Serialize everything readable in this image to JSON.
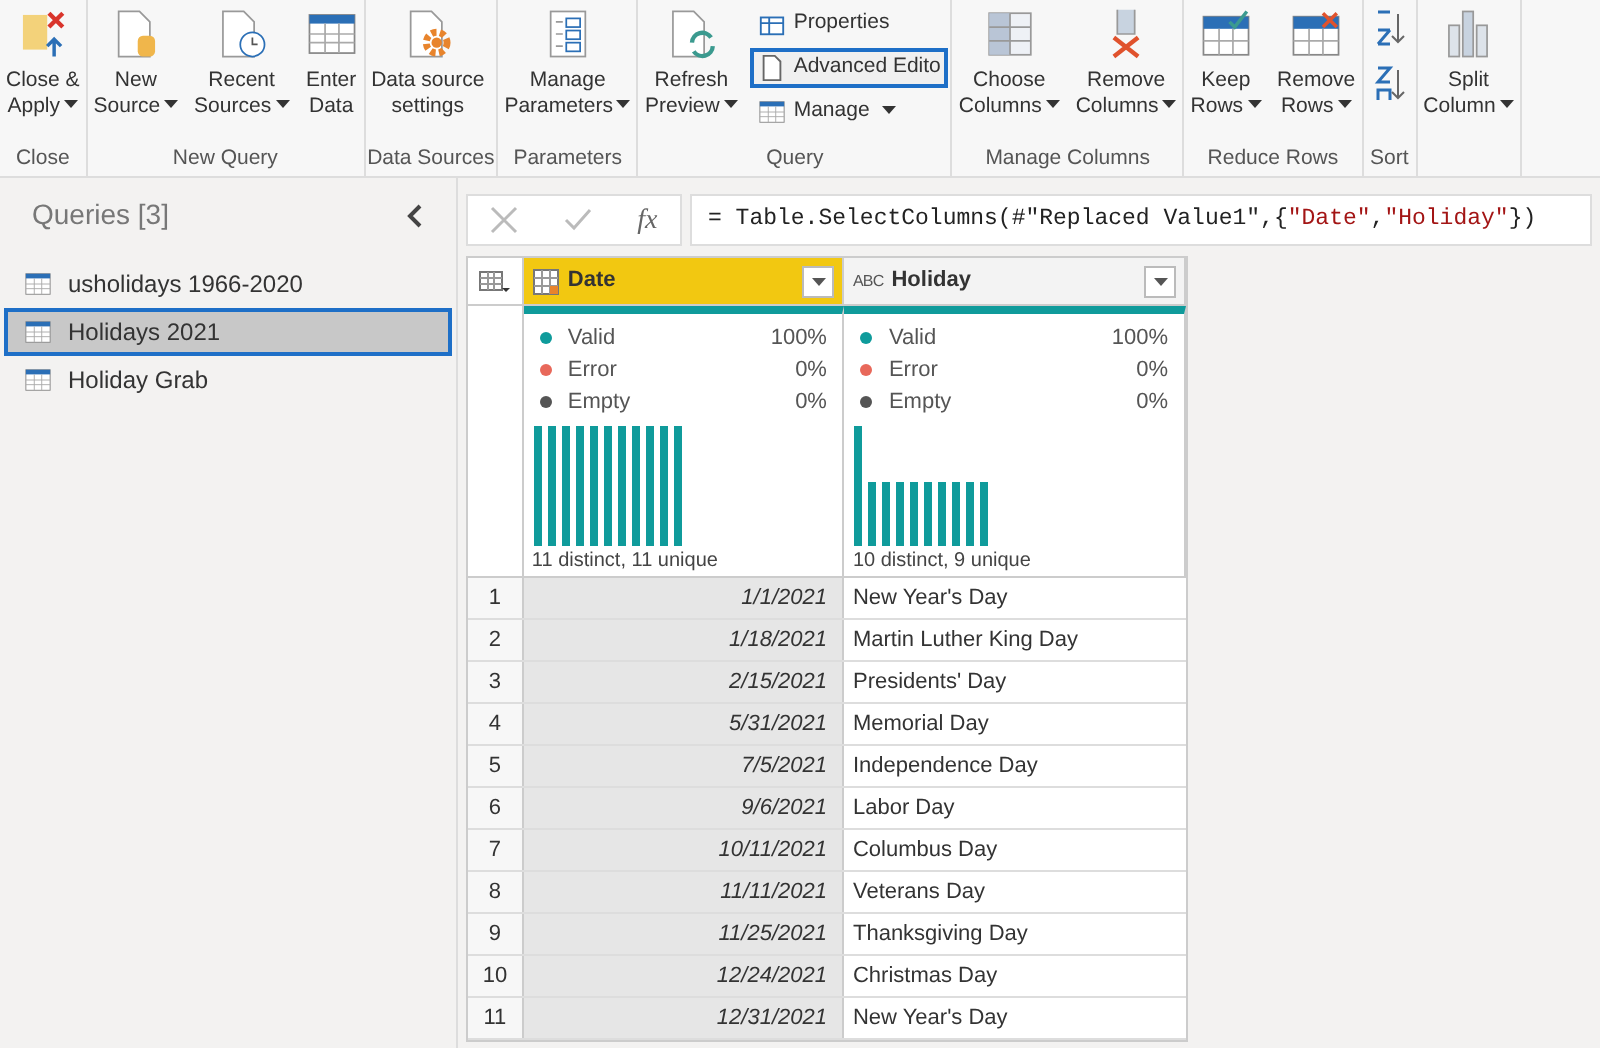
{
  "ribbon": {
    "groups": [
      {
        "label": "Close",
        "items": [
          {
            "kind": "large",
            "lines": [
              "Close &",
              "Apply"
            ],
            "dropdown": true
          }
        ]
      },
      {
        "label": "New Query",
        "items": [
          {
            "kind": "large",
            "lines": [
              "New",
              "Source"
            ],
            "dropdown": true
          },
          {
            "kind": "large",
            "lines": [
              "Recent",
              "Sources"
            ],
            "dropdown": true
          },
          {
            "kind": "large",
            "lines": [
              "Enter",
              "Data"
            ],
            "dropdown": false
          }
        ]
      },
      {
        "label": "Data Sources",
        "items": [
          {
            "kind": "large",
            "lines": [
              "Data source",
              "settings"
            ],
            "dropdown": false
          }
        ]
      },
      {
        "label": "Parameters",
        "items": [
          {
            "kind": "large",
            "lines": [
              "Manage",
              "Parameters"
            ],
            "dropdown": true
          }
        ]
      },
      {
        "label": "Query",
        "items": [
          {
            "kind": "large",
            "lines": [
              "Refresh",
              "Preview"
            ],
            "dropdown": true
          },
          {
            "kind": "stack",
            "entries": [
              {
                "label": "Properties",
                "dropdown": false,
                "highlighted": false
              },
              {
                "label": "Advanced Edito",
                "dropdown": false,
                "highlighted": true
              },
              {
                "label": "Manage",
                "dropdown": true,
                "highlighted": false
              }
            ]
          }
        ]
      },
      {
        "label": "Manage Columns",
        "items": [
          {
            "kind": "large",
            "lines": [
              "Choose",
              "Columns"
            ],
            "dropdown": true
          },
          {
            "kind": "large",
            "lines": [
              "Remove",
              "Columns"
            ],
            "dropdown": true
          }
        ]
      },
      {
        "label": "Reduce Rows",
        "items": [
          {
            "kind": "large",
            "lines": [
              "Keep",
              "Rows"
            ],
            "dropdown": true
          },
          {
            "kind": "large",
            "lines": [
              "Remove",
              "Rows"
            ],
            "dropdown": true
          }
        ]
      },
      {
        "label": "Sort",
        "items": [
          {
            "kind": "sort"
          }
        ]
      },
      {
        "items": [
          {
            "kind": "large",
            "lines": [
              "Split",
              "Column"
            ],
            "dropdown": true
          }
        ]
      }
    ]
  },
  "queries": {
    "title": "Queries [3]",
    "items": [
      {
        "label": "usholidays 1966-2020",
        "selected": false
      },
      {
        "label": "Holidays 2021",
        "selected": true
      },
      {
        "label": "Holiday Grab",
        "selected": false
      }
    ]
  },
  "formula_bar": {
    "fx_label": "fx",
    "segments": [
      {
        "kind": "code",
        "text": "= Table.SelectColumns(#\"Replaced Value1\",{"
      },
      {
        "kind": "string",
        "text": "\"Date\""
      },
      {
        "kind": "code",
        "text": ", "
      },
      {
        "kind": "string",
        "text": "\"Holiday\""
      },
      {
        "kind": "code",
        "text": "})"
      }
    ]
  },
  "table": {
    "columns": [
      {
        "name": "Date",
        "kind": "date",
        "selected": true,
        "profile": [
          {
            "label": "Valid",
            "value": "100%"
          },
          {
            "label": "Error",
            "value": "0%"
          },
          {
            "label": "Empty",
            "value": "0%"
          }
        ],
        "distinct": "11 distinct, 11 unique"
      },
      {
        "name": "Holiday",
        "kind": "text",
        "type_label": "ABC",
        "selected": false,
        "profile": [
          {
            "label": "Valid",
            "value": "100%"
          },
          {
            "label": "Error",
            "value": "0%"
          },
          {
            "label": "Empty",
            "value": "0%"
          }
        ],
        "distinct": "10 distinct, 9 unique"
      }
    ],
    "rows": [
      {
        "num": "1",
        "date": "1/1/2021",
        "holiday": "New Year's Day"
      },
      {
        "num": "2",
        "date": "1/18/2021",
        "holiday": "Martin Luther King Day"
      },
      {
        "num": "3",
        "date": "2/15/2021",
        "holiday": "Presidents' Day"
      },
      {
        "num": "4",
        "date": "5/31/2021",
        "holiday": "Memorial Day"
      },
      {
        "num": "5",
        "date": "7/5/2021",
        "holiday": "Independence Day"
      },
      {
        "num": "6",
        "date": "9/6/2021",
        "holiday": "Labor Day"
      },
      {
        "num": "7",
        "date": "10/11/2021",
        "holiday": "Columbus Day"
      },
      {
        "num": "8",
        "date": "11/11/2021",
        "holiday": "Veterans Day"
      },
      {
        "num": "9",
        "date": "11/25/2021",
        "holiday": "Thanksgiving Day"
      },
      {
        "num": "10",
        "date": "12/24/2021",
        "holiday": "Christmas Day"
      },
      {
        "num": "11",
        "date": "12/31/2021",
        "holiday": "New Year's Day"
      }
    ]
  }
}
